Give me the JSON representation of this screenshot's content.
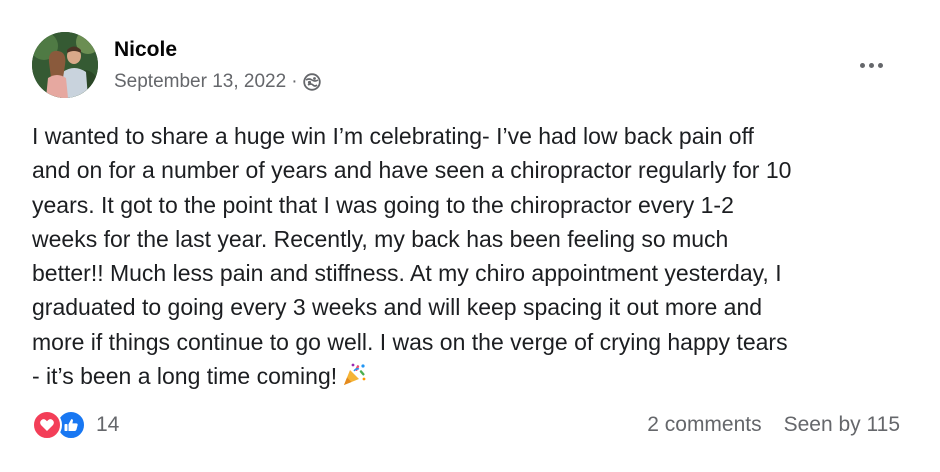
{
  "post": {
    "author": "Nicole",
    "date": "September 13, 2022",
    "separator": "·",
    "audience_icon": "globe-icon",
    "menu_icon": "more-options-icon",
    "text": "I wanted to share a huge win I’m celebrating- I’ve had low back pain off\nand on for a number of years and have seen a chiropractor regularly for 10\nyears. It got to the point that I was going to the chiropractor every 1-2\nweeks for the last year. Recently, my back has been feeling so much\nbetter!! Much less pain and stiffness. At my chiro appointment yesterday, I\ngraduated to going every 3 weeks and will keep spacing it out more and\nmore if things continue to go well. I was on the verge of crying happy tears\n- it’s been a long time coming!",
    "emoji_icon": "party-popper-icon"
  },
  "footer": {
    "reactions": [
      "love",
      "like"
    ],
    "reaction_count": "14",
    "comments": "2 comments",
    "seen": "Seen by 115"
  },
  "colors": {
    "love": "#f33e58",
    "like": "#1877f2",
    "secondary_text": "#65676b"
  }
}
